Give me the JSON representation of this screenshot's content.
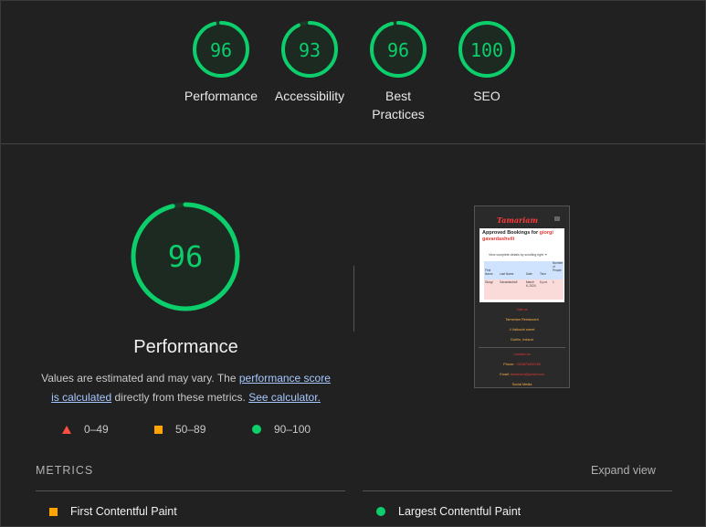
{
  "categories": [
    {
      "score": "96",
      "label": "Performance",
      "fraction": 0.96
    },
    {
      "score": "93",
      "label": "Accessibility",
      "fraction": 0.93
    },
    {
      "score": "96",
      "label": "Best Practices",
      "fraction": 0.96
    },
    {
      "score": "100",
      "label": "SEO",
      "fraction": 1.0
    }
  ],
  "main": {
    "score": "96",
    "fraction": 0.96,
    "title": "Performance",
    "desc_prefix": "Values are estimated and may vary. The ",
    "desc_link1": "performance score is calculated",
    "desc_middle": " directly from these metrics. ",
    "desc_link2": "See calculator.",
    "colors": {
      "pass": "#0cce6b",
      "average": "#ffa400",
      "fail": "#ff4e42"
    }
  },
  "legend": [
    {
      "icon": "red-triangle-icon",
      "range": "0–49"
    },
    {
      "icon": "orange-square-icon",
      "range": "50–89"
    },
    {
      "icon": "green-circle-icon",
      "range": "90–100"
    }
  ],
  "screenshot": {
    "logo": "Tamariam",
    "heading": "Approved Bookings for",
    "heading_name": "giorgi",
    "heading_name2": "gavardashvili",
    "link": "View complete details by scrolling right",
    "table_headers": [
      "First Name",
      "Last Name",
      "Date",
      "Time",
      "Number of People"
    ],
    "table_row": [
      "Giorgi",
      "Gavardashvili",
      "March 6, 2024",
      "6 p.m.",
      "1"
    ],
    "visit_us": "Visit us",
    "address": [
      "Tamariam Restaurant",
      "4 Valkuzhi street",
      "Dublin, Ireland"
    ],
    "contact_us": "Contact us",
    "phone_label": "Phone:",
    "phone": "+353873456789",
    "email_label": "Email:",
    "email": "tamariam@gmail.com",
    "social": "Social Media"
  },
  "metrics": {
    "heading": "METRICS",
    "expand": "Expand view",
    "items": [
      {
        "icon": "orange-square-icon",
        "label": "First Contentful Paint"
      },
      {
        "icon": "green-circle-icon",
        "label": "Largest Contentful Paint"
      }
    ]
  }
}
